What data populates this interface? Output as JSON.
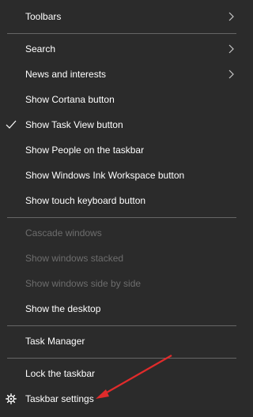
{
  "menu": {
    "items": [
      {
        "label": "Toolbars",
        "submenu": true,
        "enabled": true
      },
      {
        "label": "Search",
        "submenu": true,
        "enabled": true
      },
      {
        "label": "News and interests",
        "submenu": true,
        "enabled": true
      },
      {
        "label": "Show Cortana button",
        "enabled": true
      },
      {
        "label": "Show Task View button",
        "checked": true,
        "enabled": true
      },
      {
        "label": "Show People on the taskbar",
        "enabled": true
      },
      {
        "label": "Show Windows Ink Workspace button",
        "enabled": true
      },
      {
        "label": "Show touch keyboard button",
        "enabled": true
      },
      {
        "label": "Cascade windows",
        "enabled": false
      },
      {
        "label": "Show windows stacked",
        "enabled": false
      },
      {
        "label": "Show windows side by side",
        "enabled": false
      },
      {
        "label": "Show the desktop",
        "enabled": true
      },
      {
        "label": "Task Manager",
        "enabled": true
      },
      {
        "label": "Lock the taskbar",
        "enabled": true
      },
      {
        "label": "Taskbar settings",
        "icon": "gear-icon",
        "enabled": true
      }
    ]
  },
  "colors": {
    "background": "#2b2b2b",
    "text": "#ffffff",
    "disabled_text": "#6d6d6d",
    "separator": "#666666",
    "annotation_arrow": "#e02b2b"
  }
}
